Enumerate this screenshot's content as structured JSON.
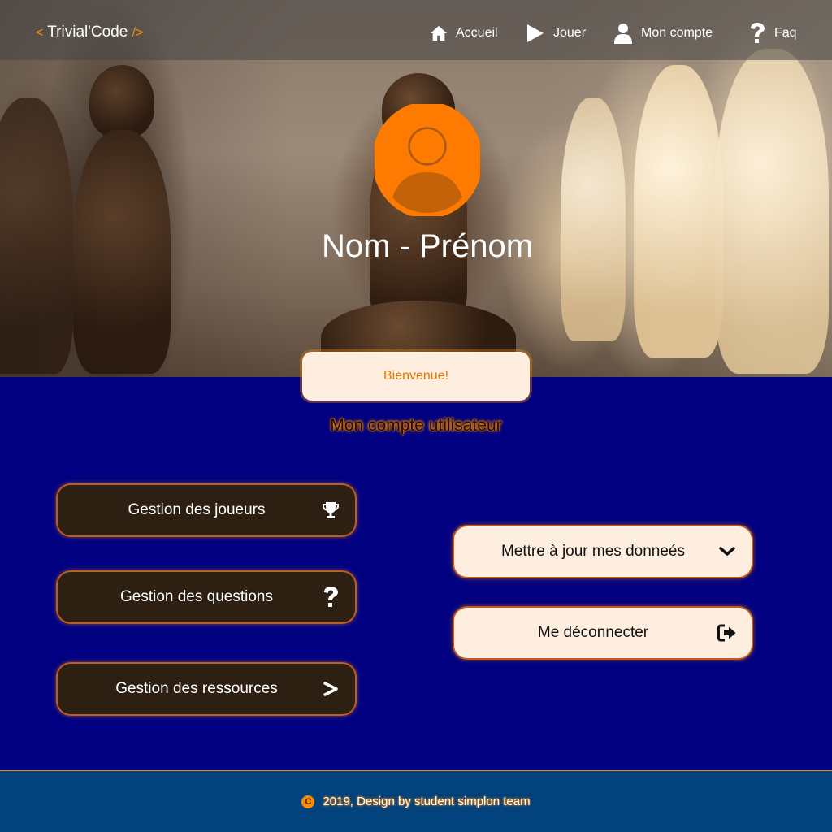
{
  "brand": {
    "open": "<",
    "name": "Trivial'Code",
    "close": "/>"
  },
  "nav": [
    {
      "label": "Accueil",
      "icon": "home-icon"
    },
    {
      "label": "Jouer",
      "icon": "play-icon"
    },
    {
      "label": "Mon compte",
      "icon": "user-icon"
    },
    {
      "label": "Faq",
      "icon": "question-icon"
    }
  ],
  "profile": {
    "name": "Nom - Prénom",
    "avatar_icon": "user-circle-icon"
  },
  "welcome": "Bienvenue!",
  "section_title": "Mon compte utilisateur",
  "admin_buttons": [
    {
      "label": "Gestion des joueurs",
      "icon": "trophy-icon"
    },
    {
      "label": "Gestion des questions",
      "icon": "question-icon"
    },
    {
      "label": "Gestion des ressources",
      "icon": "chevron-right-icon"
    }
  ],
  "account_buttons": [
    {
      "label": "Mettre à jour mes donneés",
      "icon": "chevron-down-icon"
    },
    {
      "label": "Me déconnecter",
      "icon": "sign-out-icon"
    }
  ],
  "footer": {
    "text": "2019, Design by student simplon team",
    "icon": "copyright-icon"
  },
  "colors": {
    "accent": "#ff8a00",
    "page_bg": "#010080",
    "footer_bg": "#02427d",
    "dark_button": "#2e1f13",
    "light_button": "#fdeee0"
  }
}
